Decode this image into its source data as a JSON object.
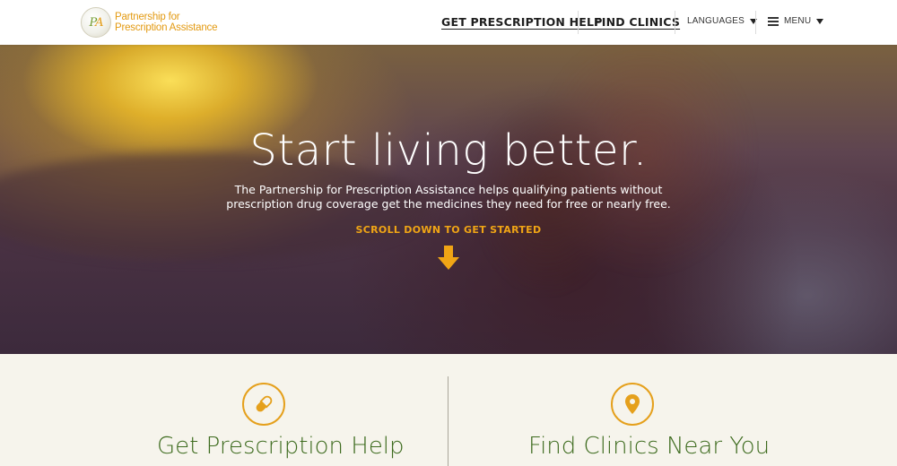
{
  "header": {
    "logo_line1": "Partnership for",
    "logo_line2": "Prescription Assistance",
    "nav_prescription_help": "GET PRESCRIPTION HELP",
    "nav_find_clinics": "FIND CLINICS",
    "languages_label": "LANGUAGES",
    "menu_label": "MENU"
  },
  "hero": {
    "title": "Start living better.",
    "subtitle": "The Partnership for Prescription Assistance helps qualifying patients without prescription drug coverage get the medicines they need for free or nearly free.",
    "scroll_cta": "SCROLL DOWN TO GET STARTED"
  },
  "features": [
    {
      "title": "Get Prescription Help",
      "icon": "pill-icon"
    },
    {
      "title": "Find Clinics Near You",
      "icon": "map-pin-icon"
    }
  ],
  "colors": {
    "accent": "#f0a515",
    "green": "#3d6b1e",
    "background": "#f6f4ec"
  }
}
